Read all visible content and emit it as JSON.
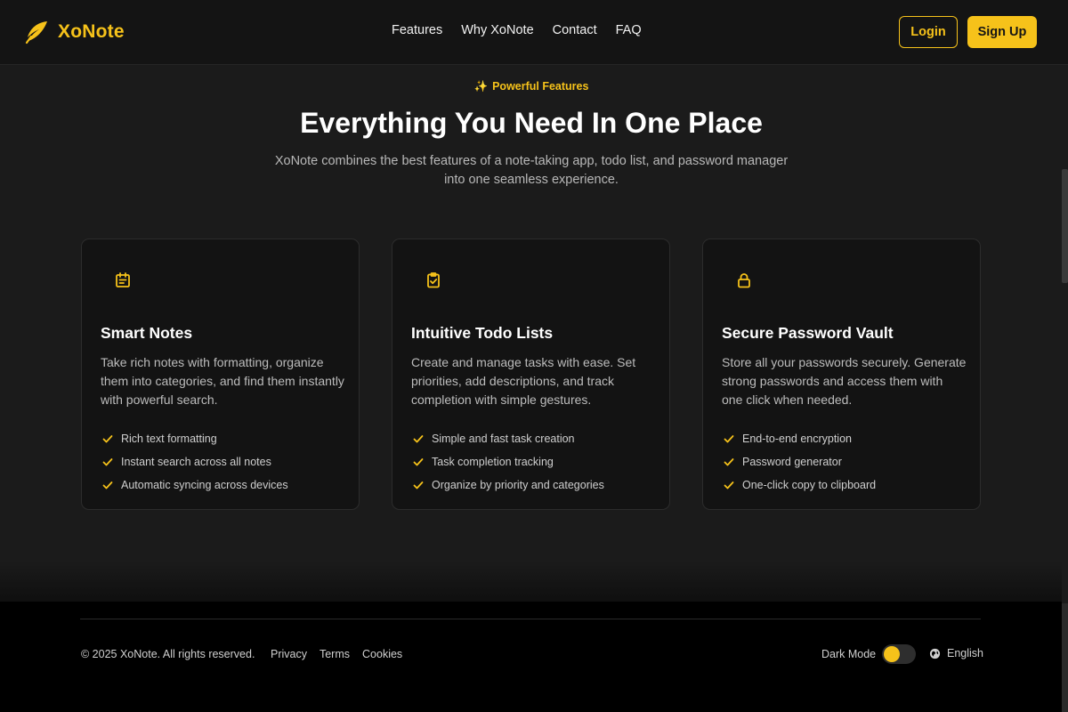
{
  "brand": {
    "name": "XoNote",
    "accent": "#f6c21a"
  },
  "nav": [
    "Features",
    "Why XoNote",
    "Contact",
    "FAQ"
  ],
  "auth": {
    "login": "Login",
    "signup": "Sign Up"
  },
  "section": {
    "badge": "Powerful Features",
    "badge_icon": "sparkles-icon",
    "title": "Everything You Need In One Place",
    "subtitle": "XoNote combines the best features of a note-taking app, todo list, and password manager into one seamless experience."
  },
  "cards": [
    {
      "icon": "notepad-icon",
      "title": "Smart Notes",
      "description": "Take rich notes with formatting, organize them into categories, and find them instantly with powerful search.",
      "features": [
        "Rich text formatting",
        "Instant search across all notes",
        "Automatic syncing across devices"
      ]
    },
    {
      "icon": "clipboard-check-icon",
      "title": "Intuitive Todo Lists",
      "description": "Create and manage tasks with ease. Set priorities, add descriptions, and track completion with simple gestures.",
      "features": [
        "Simple and fast task creation",
        "Task completion tracking",
        "Organize by priority and categories"
      ]
    },
    {
      "icon": "lock-icon",
      "title": "Secure Password Vault",
      "description": "Store all your passwords securely. Generate strong passwords and access them with one click when needed.",
      "features": [
        "End-to-end encryption",
        "Password generator",
        "One-click copy to clipboard"
      ]
    }
  ],
  "footer": {
    "copyright": "© 2025 XoNote. All rights reserved.",
    "links": [
      "Privacy",
      "Terms",
      "Cookies"
    ],
    "dark_mode_label": "Dark Mode",
    "dark_mode_on": true,
    "language": "English"
  }
}
